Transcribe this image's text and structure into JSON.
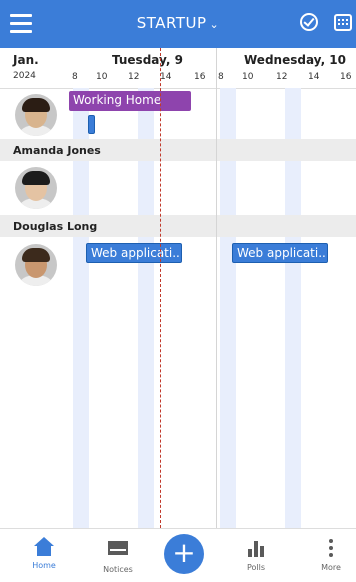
{
  "app": {
    "title": "STARTUP"
  },
  "header": {
    "month": "Jan.",
    "year": "2024",
    "day1": "Tuesday, 9",
    "day2": "Wednesday, 10",
    "ticks": [
      "8",
      "10",
      "12",
      "14",
      "16",
      "8",
      "10",
      "12",
      "14",
      "16"
    ]
  },
  "rows": [
    {
      "name": "",
      "events": [
        {
          "title": "Working Home",
          "color": "#8e44ad"
        }
      ]
    },
    {
      "name": "Amanda Jones",
      "events": []
    },
    {
      "name": "Douglas Long",
      "events": [
        {
          "title": "Web applicati..."
        },
        {
          "title": "Web applicati..."
        }
      ]
    }
  ],
  "nav": {
    "home": "Home",
    "notices": "Notices",
    "add": "+",
    "polls": "Polls",
    "more": "More"
  },
  "colors": {
    "accent": "#3b7dd8",
    "purple": "#8e44ad",
    "now_line": "#c0392b"
  },
  "icons": [
    "menu-icon",
    "chevron-down-icon",
    "check-circle-icon",
    "calendar-icon",
    "home-icon",
    "envelope-icon",
    "plus-icon",
    "bar-chart-icon",
    "more-vertical-icon"
  ]
}
